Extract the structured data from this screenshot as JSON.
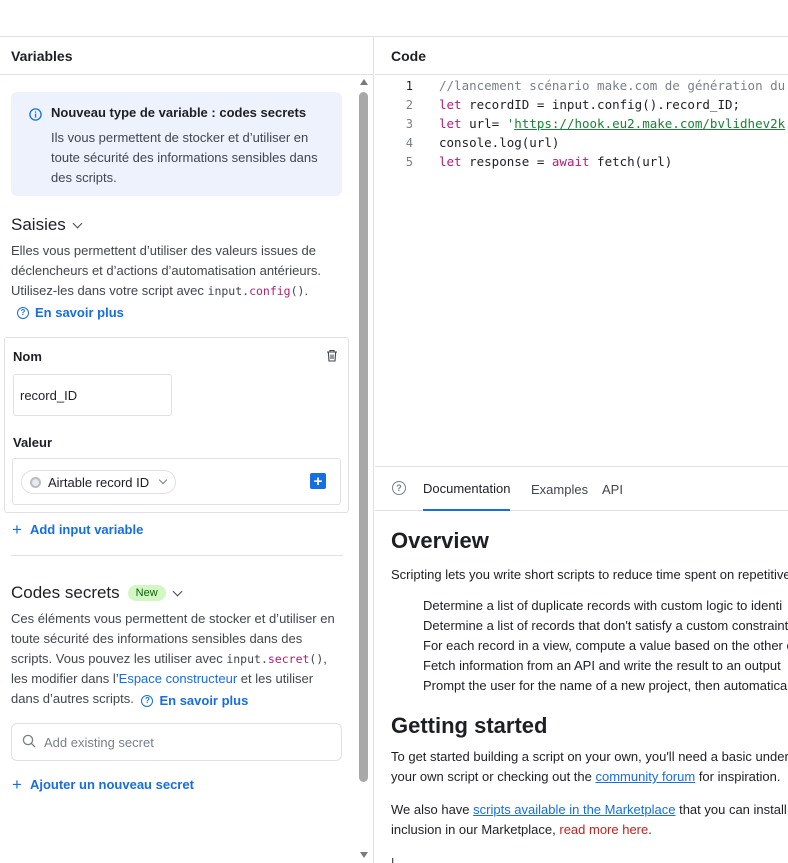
{
  "left_panel": {
    "header": "Variables",
    "callout": {
      "title": "Nouveau type de variable : codes secrets",
      "body": "Ils vous permettent de stocker et d’utiliser en toute sécurité des informations sensibles dans des scripts."
    },
    "inputs_section": {
      "title": "Saisies",
      "desc_prefix": "Elles vous permettent d’utiliser des valeurs issues de déclencheurs et d’actions d’automatisation antérieurs. Utilisez-les dans votre script avec ",
      "code_obj": "input.",
      "code_fn": "config",
      "code_paren": "()",
      "desc_suffix": ".",
      "learn_more": "En savoir plus"
    },
    "variable": {
      "name_label": "Nom",
      "name_value": "record_ID",
      "value_label": "Valeur",
      "value_pill": "Airtable record ID"
    },
    "add_input": "Add input variable",
    "secrets_section": {
      "title": "Codes secrets",
      "badge": "New",
      "desc_1": "Ces éléments vous permettent de stocker et d’utiliser en toute sécurité des informations sensibles dans des scripts. Vous pouvez les utiliser avec ",
      "code_obj": "input.",
      "code_fn": "secret",
      "code_paren": "()",
      "desc_2": ", les modifier dans l’",
      "builder_link": "Espace constructeur",
      "desc_3": " et les utiliser dans d’autres scripts.",
      "learn_more": "En savoir plus",
      "search_placeholder": "Add existing secret",
      "add_secret": "Ajouter un nouveau secret"
    }
  },
  "code_panel": {
    "header": "Code",
    "lines": [
      {
        "num": "1",
        "comment": "//lancement scénario make.com de génération du"
      },
      {
        "num": "2",
        "kw": "let",
        "rest": " recordID = input.config().record_ID;"
      },
      {
        "num": "3",
        "kw": "let",
        "mid": " url= ",
        "str_q": "'",
        "url": "https://hook.eu2.make.com/bvlidhev2k"
      },
      {
        "num": "4",
        "plain": "console.log(url)"
      },
      {
        "num": "5",
        "kw": "let",
        "mid": " response = ",
        "kw2": "await",
        "rest": " fetch(url)"
      }
    ]
  },
  "docs": {
    "tabs": [
      "Documentation",
      "Examples",
      "API"
    ],
    "active_tab": "Documentation",
    "overview_title": "Overview",
    "overview_intro": "Scripting lets you write short scripts to reduce time spent on repetitive",
    "bullets": [
      "Determine a list of duplicate records with custom logic to identi",
      "Determine a list of records that don't satisfy a custom constraint",
      "For each record in a view, compute a value based on the other c",
      "Fetch information from an API and write the result to an output",
      "Prompt the user for the name of a new project, then automatica"
    ],
    "getting_started_title": "Getting started",
    "gs_line1": "To get started building a script on your own, you'll need a basic under",
    "gs_line2_prefix": "your own script or checking out the ",
    "gs_community": "community forum",
    "gs_line2_suffix": " for inspiration.",
    "mk_prefix": "We also have ",
    "mk_link": "scripts available in the Marketplace",
    "mk_suffix": " that you can install o",
    "mk_line2": "inclusion in our Marketplace, ",
    "mk_readmore": "read more here",
    "mk_end": ".",
    "cut_line": "L... ... ... ... ... ... ... ... ... ... ... ... ... ... ... ... ... ... ... ... ..."
  },
  "colors": {
    "accent": "#166ee1",
    "callout_bg": "#eef2fd",
    "badge_bg": "#d2f7c5",
    "keyword": "#b01e75",
    "string": "#1a7f37"
  }
}
